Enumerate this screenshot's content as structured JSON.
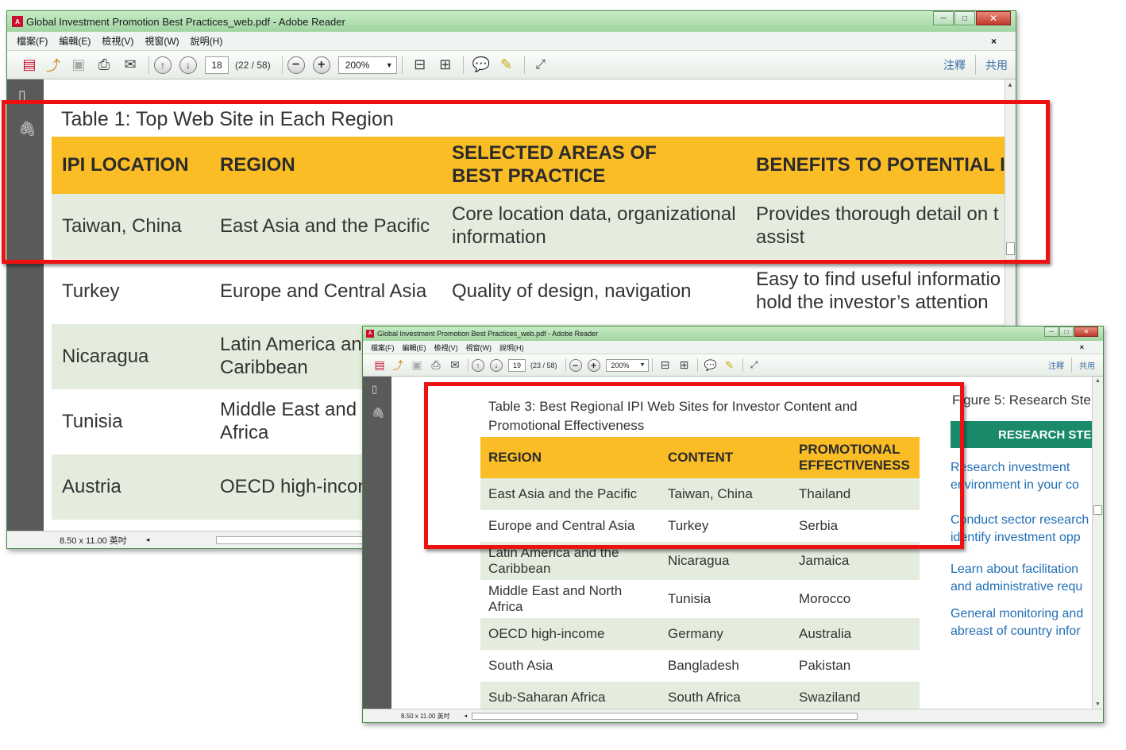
{
  "win1": {
    "title": "Global Investment Promotion Best Practices_web.pdf - Adobe Reader",
    "menu": [
      "檔案(F)",
      "編輯(E)",
      "檢視(V)",
      "視窗(W)",
      "說明(H)"
    ],
    "page_input": "18",
    "page_count": "(22 / 58)",
    "zoom": "200%",
    "comment_label": "注釋",
    "share_label": "共用",
    "status_size": "8.50 x 11.00 英吋",
    "table_title": "Table 1: Top Web Site in Each Region",
    "headers": [
      "IPI LOCATION",
      "REGION",
      "SELECTED AREAS OF BEST PRACTICE",
      "BENEFITS TO POTENTIAL IN"
    ],
    "rows": [
      [
        "Taiwan, China",
        "East Asia and the Pacific",
        "Core location data, organizational information",
        "Provides thorough detail on t assist"
      ],
      [
        "Turkey",
        "Europe and Central Asia",
        "Quality of design, navigation",
        "Easy to find useful informatio hold the investor’s attention"
      ],
      [
        "Nicaragua",
        "Latin America and Caribbean",
        "",
        ""
      ],
      [
        "Tunisia",
        "Middle East and N Africa",
        "",
        ""
      ],
      [
        "Austria",
        "OECD high-incon",
        "",
        ""
      ]
    ]
  },
  "win2": {
    "title": "Global Investment Promotion Best Practices_web.pdf - Adobe Reader",
    "menu": [
      "檔案(F)",
      "編輯(E)",
      "檢視(V)",
      "視窗(W)",
      "說明(H)"
    ],
    "page_input": "19",
    "page_count": "(23 / 58)",
    "zoom": "200%",
    "comment_label": "注釋",
    "share_label": "共用",
    "status_size": "8.50 x 11.00 英吋",
    "table_title": "Table 3: Best Regional IPI Web Sites for Investor Content and Promotional Effectiveness",
    "headers": [
      "REGION",
      "CONTENT",
      "PROMOTIONAL EFFECTIVENESS"
    ],
    "rows": [
      [
        "East Asia and the Pacific",
        "Taiwan, China",
        "Thailand"
      ],
      [
        "Europe and Central Asia",
        "Turkey",
        "Serbia"
      ],
      [
        "Latin America and the Caribbean",
        "Nicaragua",
        "Jamaica"
      ],
      [
        "Middle East and North Africa",
        "Tunisia",
        "Morocco"
      ],
      [
        "OECD high-income",
        "Germany",
        "Australia"
      ],
      [
        "South Asia",
        "Bangladesh",
        "Pakistan"
      ],
      [
        "Sub-Saharan Africa",
        "South Africa",
        "Swaziland"
      ]
    ],
    "figure_title": "Figure 5: Research Ste",
    "research_steps_label": "RESEARCH STEPS",
    "steps": [
      "Research investment environment in your co",
      "Conduct sector research identify investment opp",
      "Learn about facilitation and administrative requ",
      "General monitoring and abreast of country infor"
    ]
  },
  "colors": {
    "header_yellow": "#fbbd25",
    "row_green": "#e3ecdd",
    "highlight_red": "#ee1111",
    "link_blue": "#1f6fb5",
    "steps_header": "#1a8a6a"
  }
}
